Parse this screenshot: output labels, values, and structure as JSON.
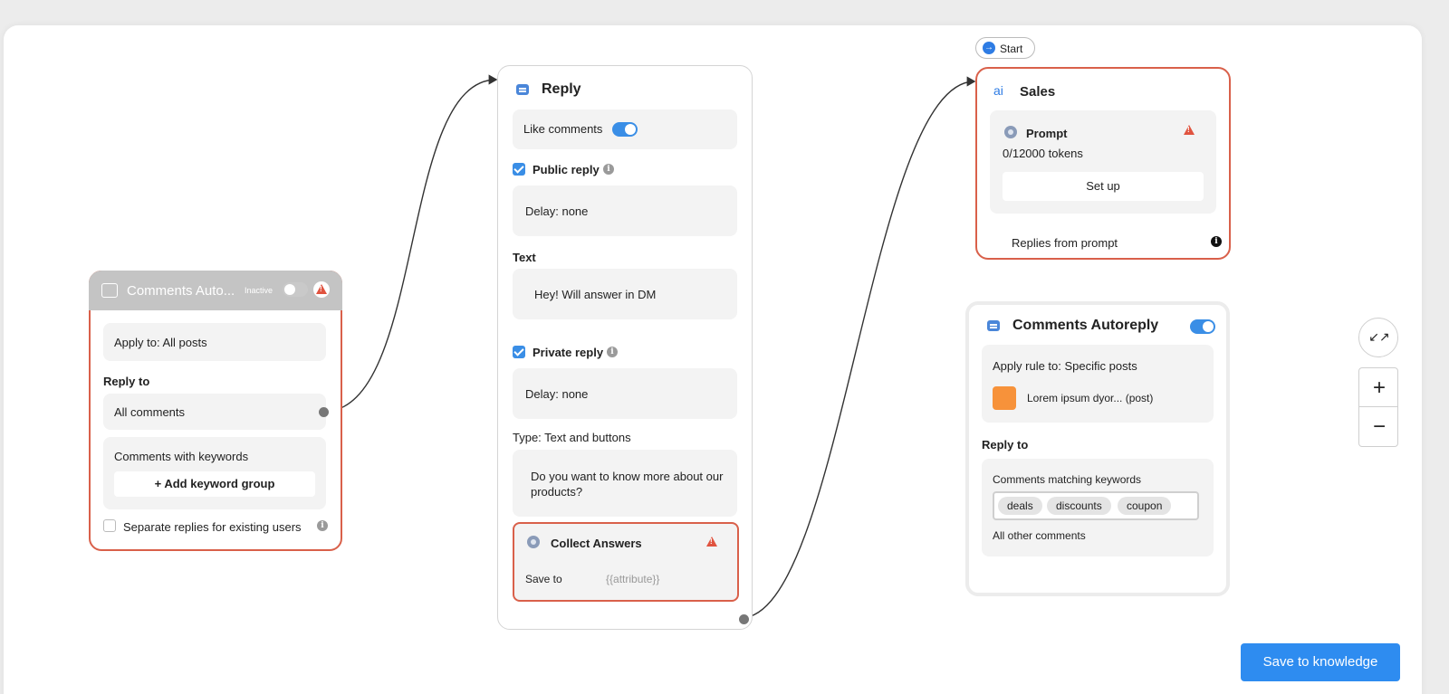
{
  "start": {
    "label": "Start"
  },
  "trigger": {
    "title": "Comments Auto...",
    "status": "Inactive",
    "apply_to": "Apply to: All posts",
    "reply_to_heading": "Reply to",
    "all_comments": "All comments",
    "keywords_label": "Comments with keywords",
    "add_keyword_group": "+ Add keyword group",
    "separate_replies": "Separate replies for existing users"
  },
  "reply": {
    "title": "Reply",
    "like_comments": "Like comments",
    "public_reply": "Public reply",
    "public_delay": "Delay: none",
    "text_label": "Text",
    "text_value": "Hey! Will answer in DM",
    "private_reply": "Private reply",
    "private_delay": "Delay: none",
    "type_label": "Type:  Text and buttons",
    "message_line1": "Do you want to know more about our",
    "message_line2": "products?",
    "collect_title": "Collect Answers",
    "save_to_label": "Save to",
    "save_to_placeholder": "{{attribute}}"
  },
  "sales": {
    "icon_text": "ai",
    "title": "Sales",
    "prompt_title": "Prompt",
    "tokens": "0/12000 tokens",
    "setup_button": "Set up",
    "replies_from_prompt": "Replies from prompt"
  },
  "autoreply": {
    "title": "Comments Autoreply",
    "apply_rule": "Apply rule to: Specific posts",
    "post_label": "Lorem ipsum dyor... (post)",
    "reply_to_heading": "Reply to",
    "matching_label": "Comments matching keywords",
    "keywords": [
      "deals",
      "discounts",
      "coupon"
    ],
    "all_other": "All other comments"
  },
  "zoom": {
    "fit_icon": "↙↗",
    "plus": "+",
    "minus": "−"
  },
  "save_button": "Save to knowledge",
  "colors": {
    "accent": "#3a8ee6",
    "error": "#d9604a",
    "save": "#2e8cf0"
  }
}
